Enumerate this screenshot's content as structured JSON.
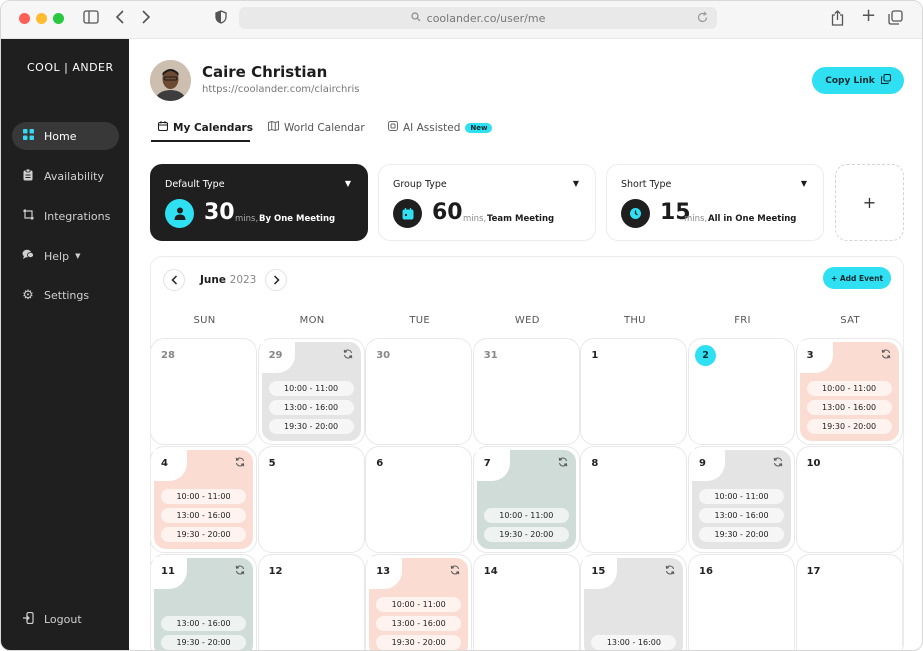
{
  "browser": {
    "url": "coolander.co/user/me"
  },
  "sidebar": {
    "logo": "COOL | ANDER",
    "items": [
      {
        "label": "Home",
        "icon": "grid-icon",
        "active": true
      },
      {
        "label": "Availability",
        "icon": "clipboard-icon",
        "active": false
      },
      {
        "label": "Integrations",
        "icon": "integrations-icon",
        "active": false
      },
      {
        "label": "Help",
        "icon": "help-icon",
        "active": false,
        "has_dropdown": true
      },
      {
        "label": "Settings",
        "icon": "gear-icon",
        "active": false
      }
    ],
    "logout": "Logout"
  },
  "user": {
    "name": "Caire Christian",
    "url": "https://coolander.com/clairchris"
  },
  "copy_link": "Copy Link",
  "tabs": [
    {
      "label": "My Calendars",
      "active": true
    },
    {
      "label": "World Calendar",
      "active": false
    },
    {
      "label": "AI Assisted",
      "active": false,
      "badge": "New"
    }
  ],
  "meeting_types": [
    {
      "title": "Default Type",
      "number": "30",
      "unit": "mins,",
      "desc": "By One Meeting",
      "icon": "person-icon",
      "dark": true
    },
    {
      "title": "Group Type",
      "number": "60",
      "unit": "mins,",
      "desc": "Team Meeting",
      "icon": "calendar-icon",
      "dark": false
    },
    {
      "title": "Short Type",
      "number": "15",
      "unit": "mins,",
      "desc": "All in One Meeting",
      "icon": "clock-icon",
      "dark": false
    }
  ],
  "add_type": "+",
  "calendar": {
    "month": "June",
    "year": "2023",
    "add_event": "+ Add Event",
    "day_names": [
      "SUN",
      "MON",
      "TUE",
      "WED",
      "THU",
      "FRI",
      "SAT"
    ],
    "weeks": [
      [
        {
          "day": "28",
          "other": true
        },
        {
          "day": "29",
          "other": true,
          "color": "gray",
          "slots": [
            "10:00 - 11:00",
            "13:00 - 16:00",
            "19:30 - 20:00"
          ]
        },
        {
          "day": "30",
          "other": true
        },
        {
          "day": "31",
          "other": true
        },
        {
          "day": "1"
        },
        {
          "day": "2",
          "today": true
        },
        {
          "day": "3",
          "color": "peach",
          "slots": [
            "10:00 - 11:00",
            "13:00 - 16:00",
            "19:30 - 20:00"
          ]
        }
      ],
      [
        {
          "day": "4",
          "color": "peach",
          "slots": [
            "10:00 - 11:00",
            "13:00 - 16:00",
            "19:30 - 20:00"
          ]
        },
        {
          "day": "5"
        },
        {
          "day": "6"
        },
        {
          "day": "7",
          "color": "sage",
          "slots": [
            "10:00 - 11:00",
            "19:30 - 20:00"
          ]
        },
        {
          "day": "8"
        },
        {
          "day": "9",
          "color": "gray",
          "slots": [
            "10:00 - 11:00",
            "13:00 - 16:00",
            "19:30 - 20:00"
          ]
        },
        {
          "day": "10"
        }
      ],
      [
        {
          "day": "11",
          "color": "sage",
          "slots": [
            "13:00 - 16:00",
            "19:30 - 20:00"
          ]
        },
        {
          "day": "12"
        },
        {
          "day": "13",
          "color": "peach",
          "slots": [
            "10:00 - 11:00",
            "13:00 - 16:00",
            "19:30 - 20:00"
          ]
        },
        {
          "day": "14"
        },
        {
          "day": "15",
          "color": "gray",
          "slots": [
            "13:00 - 16:00"
          ]
        },
        {
          "day": "16"
        },
        {
          "day": "17"
        }
      ]
    ]
  }
}
